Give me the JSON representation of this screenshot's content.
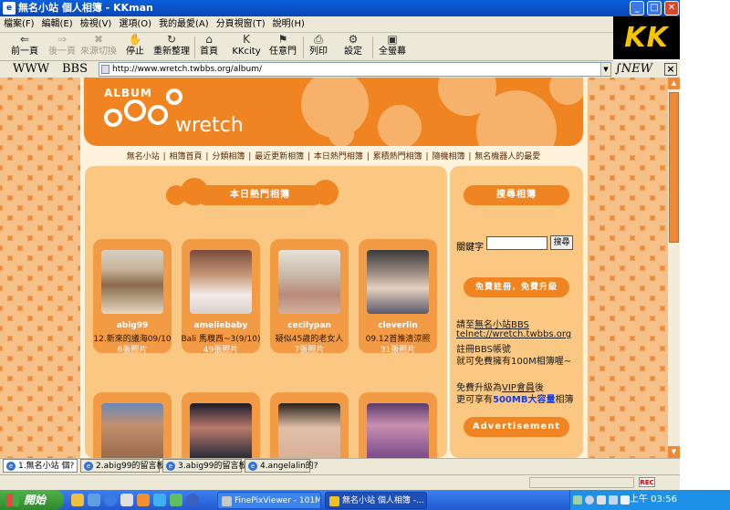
{
  "window": {
    "title": "無名小站 個人相簿 - KKman",
    "app_icon": "ie-icon",
    "controls": {
      "minimize": "_",
      "maximize": "□",
      "close": "✕"
    },
    "brand_logo": "KK"
  },
  "menubar": [
    "檔案(F)",
    "編輯(E)",
    "檢視(V)",
    "選項(O)",
    "我的最愛(A)",
    "分頁視窗(T)",
    "說明(H)"
  ],
  "toolbar": {
    "back": "前一頁",
    "forward": "後一頁",
    "switch": "來源切換",
    "stop": "停止",
    "refresh": "重新整理",
    "home": "首頁",
    "kkcity": "KKcity",
    "portal": "任意門",
    "print": "列印",
    "settings": "設定",
    "fullscreen": "全螢幕"
  },
  "address": {
    "www": "WWW",
    "bbs": "BBS",
    "url": "http://www.wretch.twbbs.org/album/",
    "new_logo": "NEW"
  },
  "page": {
    "banner": {
      "album": "ALBUM",
      "brand": "wretch"
    },
    "nav": [
      "無名小站",
      "相簿首頁",
      "分類相簿",
      "最近更新相簿",
      "本日熱門相簿",
      "累積熱門相簿",
      "隨機相簿",
      "無名機器人的最愛"
    ],
    "hot_heading": "本日熱門相簿",
    "albums": [
      {
        "user": "abig99",
        "title": "12.新來的議海09/10",
        "count": "6張照片"
      },
      {
        "user": "ameliebaby",
        "title": "Bali 馬糗西~3(9/10)",
        "count": "49張照片"
      },
      {
        "user": "cecilypan",
        "title": "疑似45歲的老女人",
        "count": "7張照片"
      },
      {
        "user": "cleverlin",
        "title": "09.12首推清涼照",
        "count": "31張照片"
      },
      {
        "user": "",
        "title": "",
        "count": ""
      },
      {
        "user": "",
        "title": "",
        "count": ""
      },
      {
        "user": "",
        "title": "",
        "count": ""
      },
      {
        "user": "",
        "title": "",
        "count": ""
      }
    ],
    "search": {
      "heading": "搜尋相簿",
      "label": "關鍵字",
      "button": "搜尋"
    },
    "register": {
      "heading": "免費註冊，免費升級",
      "line1": "請至",
      "line1_link": "無名小站BBS",
      "line2_link": "telnet://wretch.twbbs.org",
      "line3": "註冊BBS帳號",
      "line4": "就可免費擁有100M相簿喔~",
      "line5_a": "免費升級為",
      "line5_link": "VIP會員",
      "line5_b": "後",
      "line6_a": "更可享有",
      "line6_highlight": "500MB大容量",
      "line6_b": "相簿"
    },
    "ad_heading": "Advertisement"
  },
  "tabs": [
    {
      "label": "1.無名小站 個?"
    },
    {
      "label": "2.abig99的留言板"
    },
    {
      "label": "3.abig99的留言板"
    },
    {
      "label": "4.angelalin的?"
    }
  ],
  "status": {
    "rec": "REC"
  },
  "taskbar": {
    "start": "開始",
    "items": [
      {
        "label": "FinePixViewer - 101M..."
      },
      {
        "label": "無名小站 個人相簿 -..."
      }
    ],
    "clock": "上午 03:56"
  },
  "colors": {
    "accent": "#ef8421",
    "panel": "#fbc883",
    "title_blue": "#0846b8",
    "start_green": "#3c9e36"
  }
}
